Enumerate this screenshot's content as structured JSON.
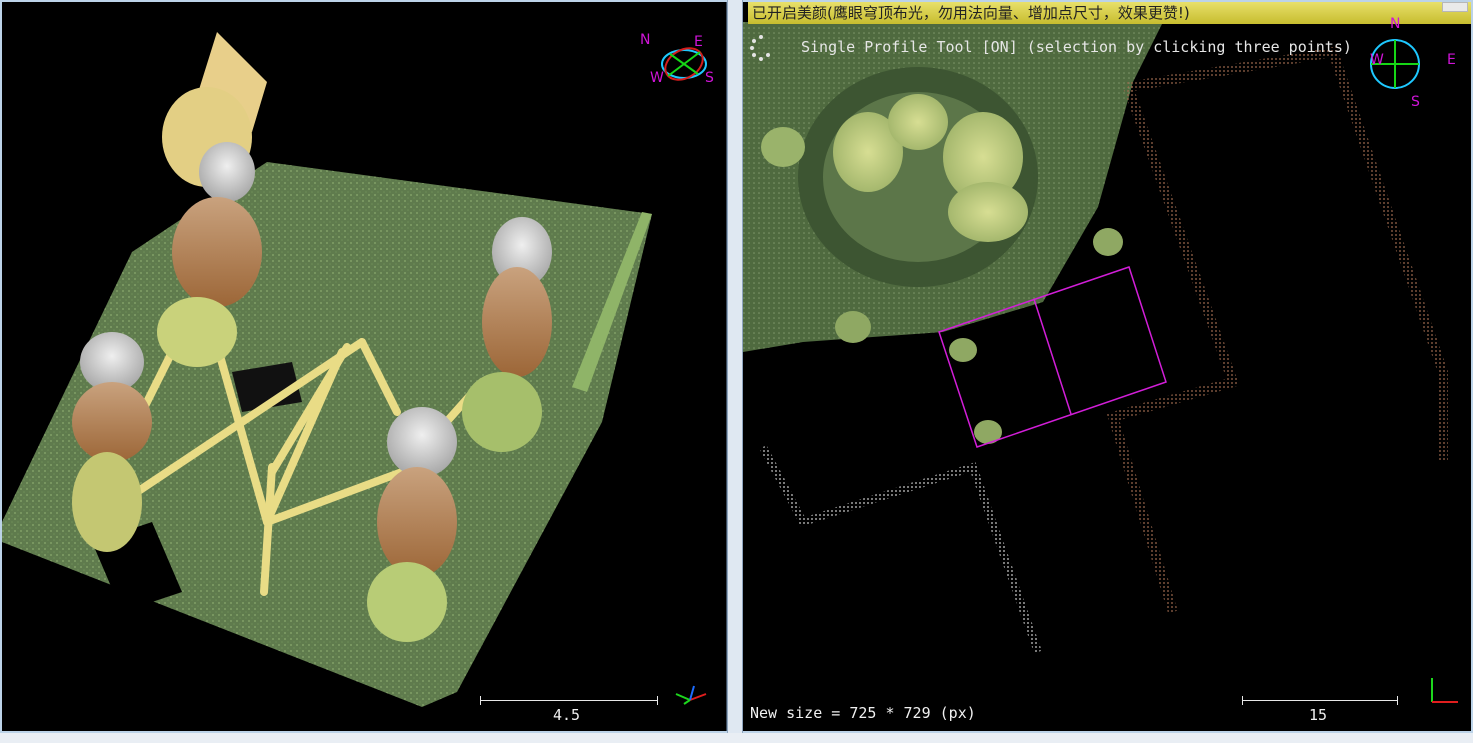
{
  "left_view": {
    "compass": {
      "n": "N",
      "e": "E",
      "w": "W",
      "s": "S"
    },
    "scale_value": "4.5"
  },
  "right_view": {
    "banner": "已开启美颜(鹰眼穹顶布光，勿用法向量、增加点尺寸，效果更赞!)",
    "tool_status": "Single Profile Tool [ON] (selection by clicking three points)",
    "compass": {
      "n": "N",
      "e": "E",
      "w": "W",
      "s": "S"
    },
    "size_readout": "New size = 725 * 729 (px)",
    "scale_value": "15"
  },
  "colors": {
    "ground": "#6b8a55",
    "trunk": "#e5d77a",
    "canopy_brown": "#b07b4a",
    "canopy_white": "#d6d6d6",
    "selection_box": "#d21ed8",
    "background": "#000000"
  },
  "icons": [
    "compass-3d-icon",
    "compass-2d-icon",
    "axis-triad-icon",
    "spinner-icon"
  ]
}
